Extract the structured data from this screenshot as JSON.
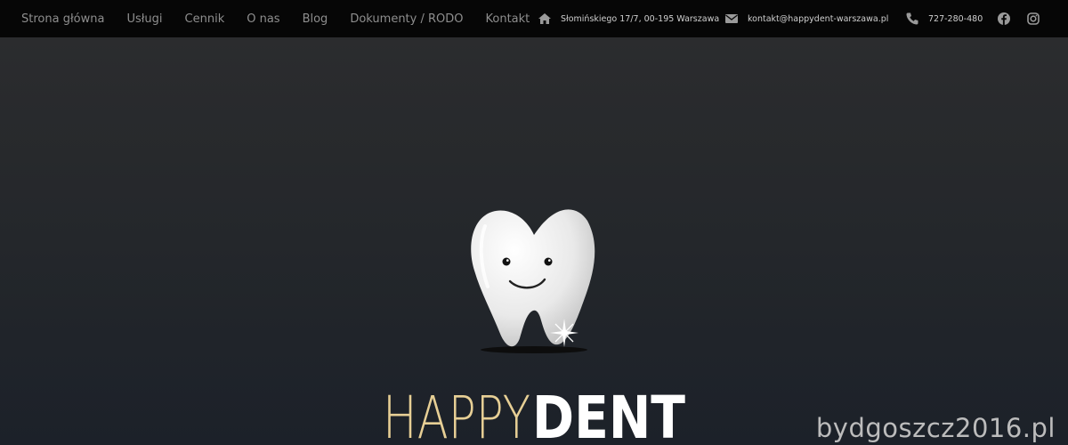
{
  "nav": {
    "items": [
      {
        "label": "Strona główna"
      },
      {
        "label": "Usługi"
      },
      {
        "label": "Cennik"
      },
      {
        "label": "O nas"
      },
      {
        "label": "Blog"
      },
      {
        "label": "Dokumenty / RODO"
      },
      {
        "label": "Kontakt"
      }
    ]
  },
  "contact": {
    "address": "Słomińskiego 17/7, 00-195 Warszawa",
    "email": "kontakt@happydent-warszawa.pl",
    "phone": "727-280-480",
    "address_icon": "home-icon",
    "email_icon": "envelope-icon",
    "phone_icon": "phone-icon"
  },
  "social": {
    "facebook_icon": "facebook-icon",
    "instagram_icon": "instagram-icon"
  },
  "logo": {
    "word_happy": "HAPPY",
    "word_dent": "DENT",
    "happy_color": "#e7cf95",
    "dent_color": "#ffffff"
  },
  "watermark": "bydgoszcz2016.pl",
  "colors": {
    "topbar_bg": "#060606",
    "nav_text": "#8e8e8e",
    "hero_bg": "#24272b"
  }
}
